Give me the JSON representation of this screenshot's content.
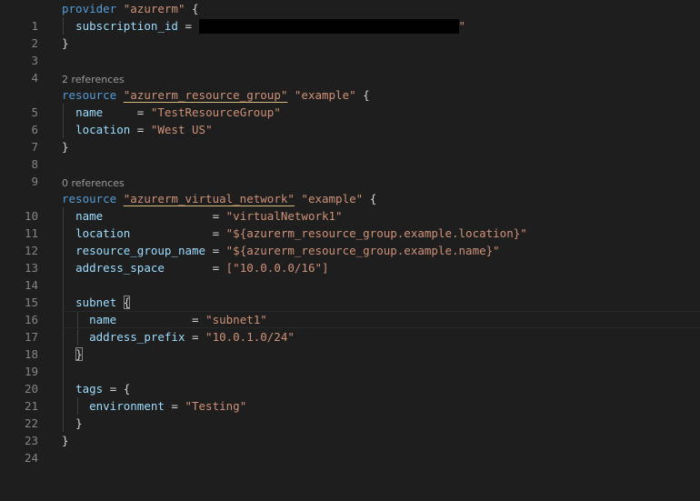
{
  "editor": {
    "codelens": {
      "resource_group_refs": "2 references",
      "virtual_network_refs": "0 references"
    },
    "line_numbers": [
      "1",
      "2",
      "3",
      "4",
      "5",
      "6",
      "7",
      "8",
      "9",
      "10",
      "11",
      "12",
      "13",
      "14",
      "15",
      "16",
      "17",
      "18",
      "19",
      "20",
      "21",
      "22",
      "23",
      "24"
    ],
    "code": {
      "l1_keyword": "provider",
      "l1_name": "\"azurerm\"",
      "l1_brace": " {",
      "l2_attr": "subscription_id",
      "l2_eq": " = ",
      "l2_tail": "\"",
      "l3_brace": "}",
      "l5_keyword": "resource",
      "l5_type": "\"azurerm_resource_group\"",
      "l5_name": " \"example\"",
      "l5_brace": " {",
      "l6_attr": "name",
      "l6_eq": "     = ",
      "l6_val": "\"TestResourceGroup\"",
      "l7_attr": "location",
      "l7_eq": " = ",
      "l7_val": "\"West US\"",
      "l8_brace": "}",
      "l10_keyword": "resource",
      "l10_type": "\"azurerm_virtual_network\"",
      "l10_name": " \"example\"",
      "l10_brace": " {",
      "l11_attr": "name",
      "l11_eq": "                = ",
      "l11_val": "\"virtualNetwork1\"",
      "l12_attr": "location",
      "l12_eq": "            = ",
      "l12_val": "\"${azurerm_resource_group.example.location}\"",
      "l13_attr": "resource_group_name",
      "l13_eq": " = ",
      "l13_val": "\"${azurerm_resource_group.example.name}\"",
      "l14_attr": "address_space",
      "l14_eq": "       = ",
      "l14_val": "[\"10.0.0.0/16\"]",
      "l16_attr": "subnet",
      "l16_brace": "{",
      "l17_attr": "name",
      "l17_eq": "           = ",
      "l17_val": "\"subnet1\"",
      "l18_attr": "address_prefix",
      "l18_eq": " = ",
      "l18_val": "\"10.0.1.0/24\"",
      "l19_brace": "}",
      "l21_attr": "tags",
      "l21_eq": " = ",
      "l21_brace": "{",
      "l22_attr": "environment",
      "l22_eq": " = ",
      "l22_val": "\"Testing\"",
      "l23_brace": "}",
      "l24_brace": "}"
    }
  },
  "colors": {
    "background": "#1e1e1e",
    "keyword": "#569cd6",
    "string": "#ce9178",
    "attribute": "#9cdcfe",
    "line_number": "#858585",
    "codelens": "#999999",
    "redaction": "#000000"
  }
}
